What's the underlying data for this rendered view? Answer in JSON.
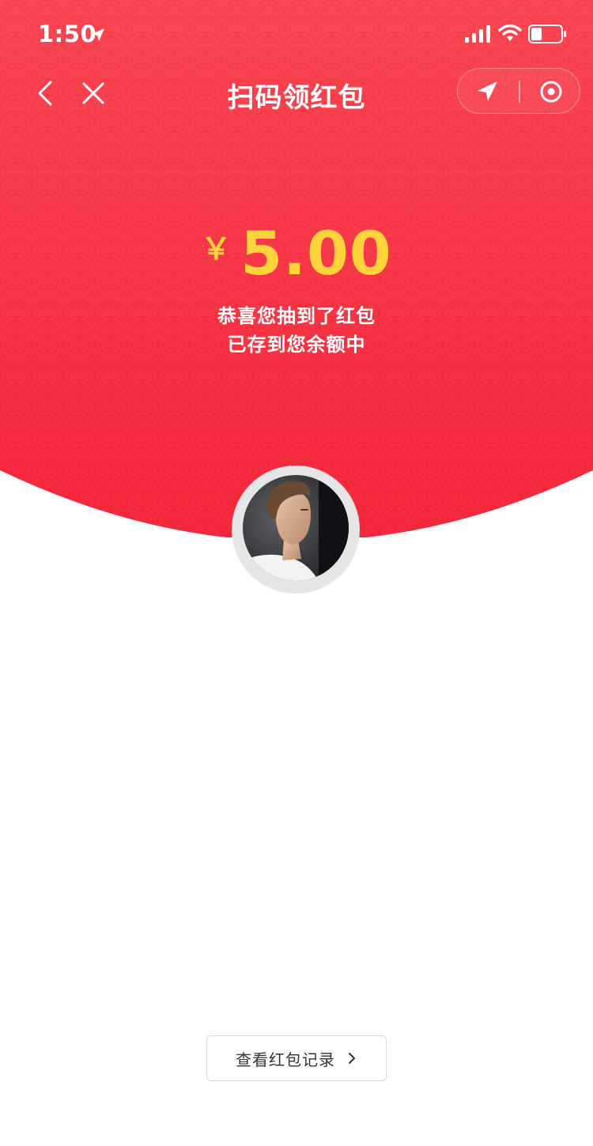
{
  "status_bar": {
    "time": "1:50",
    "icons": [
      "location-arrow-icon",
      "cellular-signal-icon",
      "wifi-icon",
      "battery-icon"
    ]
  },
  "nav": {
    "title": "扫码领红包",
    "back_icon": "chevron-left-icon",
    "close_icon": "close-icon",
    "capsule_icons": [
      "location-arrow-icon",
      "target-icon"
    ]
  },
  "red_packet": {
    "currency_symbol": "￥",
    "amount": "5.00",
    "message_line1": "恭喜您抽到了红包",
    "message_line2": "已存到您余额中"
  },
  "avatar": {
    "icon": "user-avatar"
  },
  "footer": {
    "record_button_label": "查看红包记录",
    "record_button_icon": "chevron-right-icon"
  },
  "colors": {
    "header_red_top": "#fb4752",
    "header_red_bottom": "#f5283b",
    "amount_yellow": "#ffd43b",
    "button_border": "#d8d8d8"
  }
}
